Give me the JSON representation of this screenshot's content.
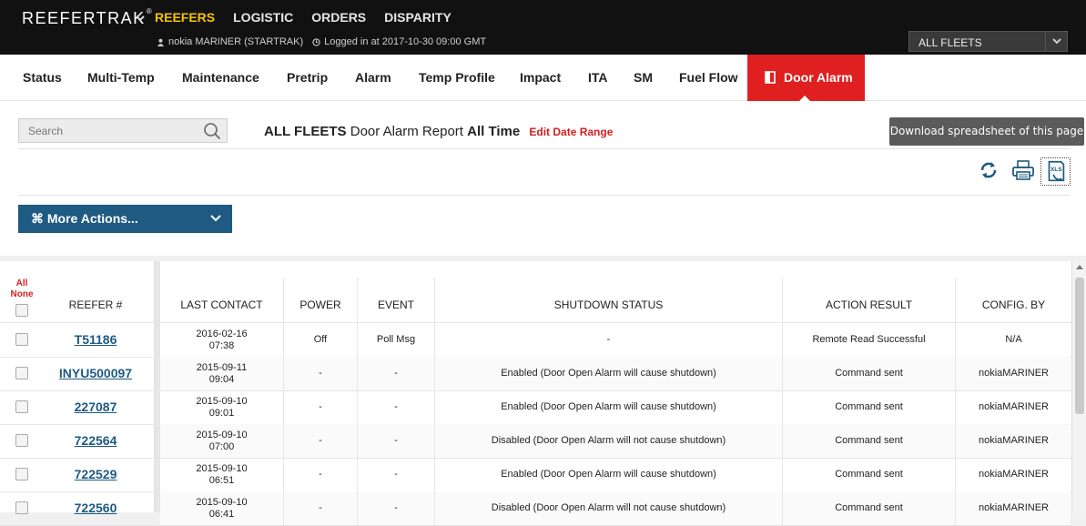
{
  "app": {
    "brand": "REEFERTRAK",
    "brand_mark": "®"
  },
  "topnav": [
    "REEFERS",
    "LOGISTIC",
    "ORDERS",
    "DISPARITY"
  ],
  "user": {
    "name": "nokia MARINER (STARTRAK)",
    "login": "Logged in at 2017-10-30 09:00 GMT"
  },
  "fleet_select": {
    "value": "ALL FLEETS"
  },
  "subnav": [
    "Status",
    "Multi-Temp",
    "Maintenance",
    "Pretrip",
    "Alarm",
    "Temp Profile",
    "Impact",
    "ITA",
    "SM",
    "Fuel Flow",
    "Door Alarm"
  ],
  "search": {
    "placeholder": "Search"
  },
  "report": {
    "fleet": "ALL FLEETS",
    "name": "Door Alarm Report",
    "range": "All Time",
    "edit": "Edit Date Range"
  },
  "tooltip": "Download spreadsheet of this page",
  "more_actions": "⌘ More Actions...",
  "select_all": {
    "all": "All",
    "none": "None"
  },
  "columns": [
    "REEFER #",
    "LAST CONTACT",
    "POWER",
    "EVENT",
    "SHUTDOWN STATUS",
    "ACTION RESULT",
    "CONFIG. BY"
  ],
  "rows": [
    {
      "reefer": "T51186",
      "date": "2016-02-16",
      "time": "07:38",
      "power": "Off",
      "event": "Poll Msg",
      "status": "-",
      "result": "Remote Read Successful",
      "by": "N/A"
    },
    {
      "reefer": "INYU500097",
      "date": "2015-09-11",
      "time": "09:04",
      "power": "-",
      "event": "-",
      "status": "Enabled (Door Open Alarm will cause shutdown)",
      "result": "Command sent",
      "by": "nokiaMARINER"
    },
    {
      "reefer": "227087",
      "date": "2015-09-10",
      "time": "09:01",
      "power": "-",
      "event": "-",
      "status": "Enabled (Door Open Alarm will cause shutdown)",
      "result": "Command sent",
      "by": "nokiaMARINER"
    },
    {
      "reefer": "722564",
      "date": "2015-09-10",
      "time": "07:00",
      "power": "-",
      "event": "-",
      "status": "Disabled (Door Open Alarm will not cause shutdown)",
      "result": "Command sent",
      "by": "nokiaMARINER"
    },
    {
      "reefer": "722529",
      "date": "2015-09-10",
      "time": "06:51",
      "power": "-",
      "event": "-",
      "status": "Enabled (Door Open Alarm will cause shutdown)",
      "result": "Command sent",
      "by": "nokiaMARINER"
    },
    {
      "reefer": "722560",
      "date": "2015-09-10",
      "time": "06:41",
      "power": "-",
      "event": "-",
      "status": "Disabled (Door Open Alarm will not cause shutdown)",
      "result": "Command sent",
      "by": "nokiaMARINER"
    }
  ],
  "colors": {
    "accent_red": "#e02020",
    "link_blue": "#1e5a82",
    "brand_yellow": "#f5c400"
  }
}
